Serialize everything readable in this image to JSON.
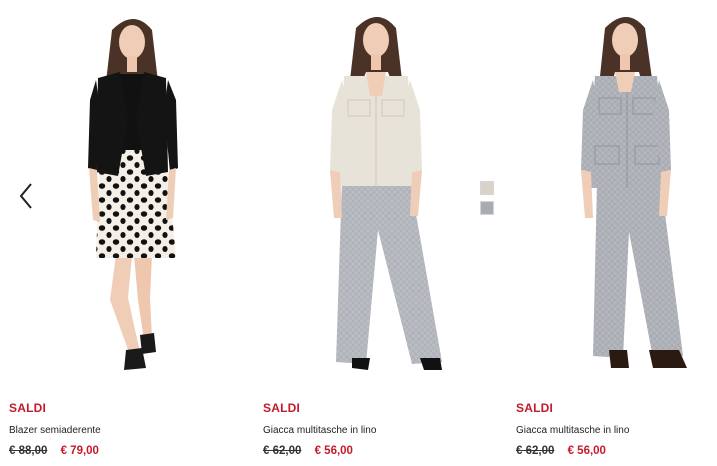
{
  "carousel": {
    "prev_icon": "chevron-left-icon",
    "swatches": [
      {
        "name": "beige",
        "color": "#d9d2c9"
      },
      {
        "name": "grey",
        "color": "#a9abb2"
      }
    ]
  },
  "colors": {
    "sale_red": "#c41a2b",
    "text": "#222222",
    "background": "#ffffff"
  },
  "products": [
    {
      "badge": "SALDI",
      "name": "Blazer semiaderente",
      "old_price": "€ 88,00",
      "new_price": "€ 79,00",
      "outfit": "black blazer with white and black polka-dot skirt"
    },
    {
      "badge": "SALDI",
      "name": "Giacca multitasche in lino",
      "old_price": "€ 62,00",
      "new_price": "€ 56,00",
      "outfit": "beige linen jacket with grey wide trousers"
    },
    {
      "badge": "SALDI",
      "name": "Giacca multitasche in lino",
      "old_price": "€ 62,00",
      "new_price": "€ 56,00",
      "outfit": "grey linen jacket with grey wide trousers"
    }
  ]
}
